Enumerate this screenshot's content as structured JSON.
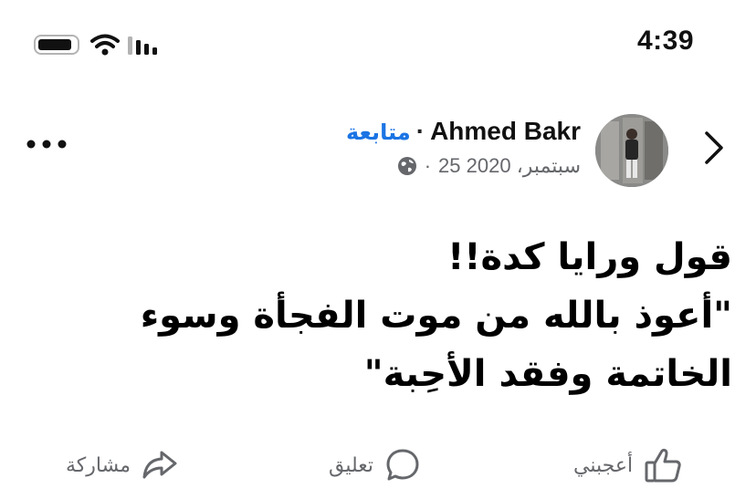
{
  "status_bar": {
    "time": "4:39",
    "icons": [
      "battery-icon",
      "wifi-icon",
      "cellular-signal-icon"
    ]
  },
  "post": {
    "author": "Ahmed Bakr",
    "separator": "·",
    "follow_label": "متابعة",
    "date": "25 سبتمبر، 2020",
    "date_separator": "·",
    "privacy_icon": "globe-icon",
    "text_lines": [
      "قول ورايا كدة!!",
      "\"أعوذ بالله من موت الفجأة وسوء",
      "الخاتمة وفقد الأحِبة\""
    ]
  },
  "actions": {
    "like_label": "أعجبني",
    "comment_label": "تعليق",
    "share_label": "مشاركة"
  },
  "colors": {
    "accent": "#1b74e4",
    "secondary_text": "#65676b"
  }
}
